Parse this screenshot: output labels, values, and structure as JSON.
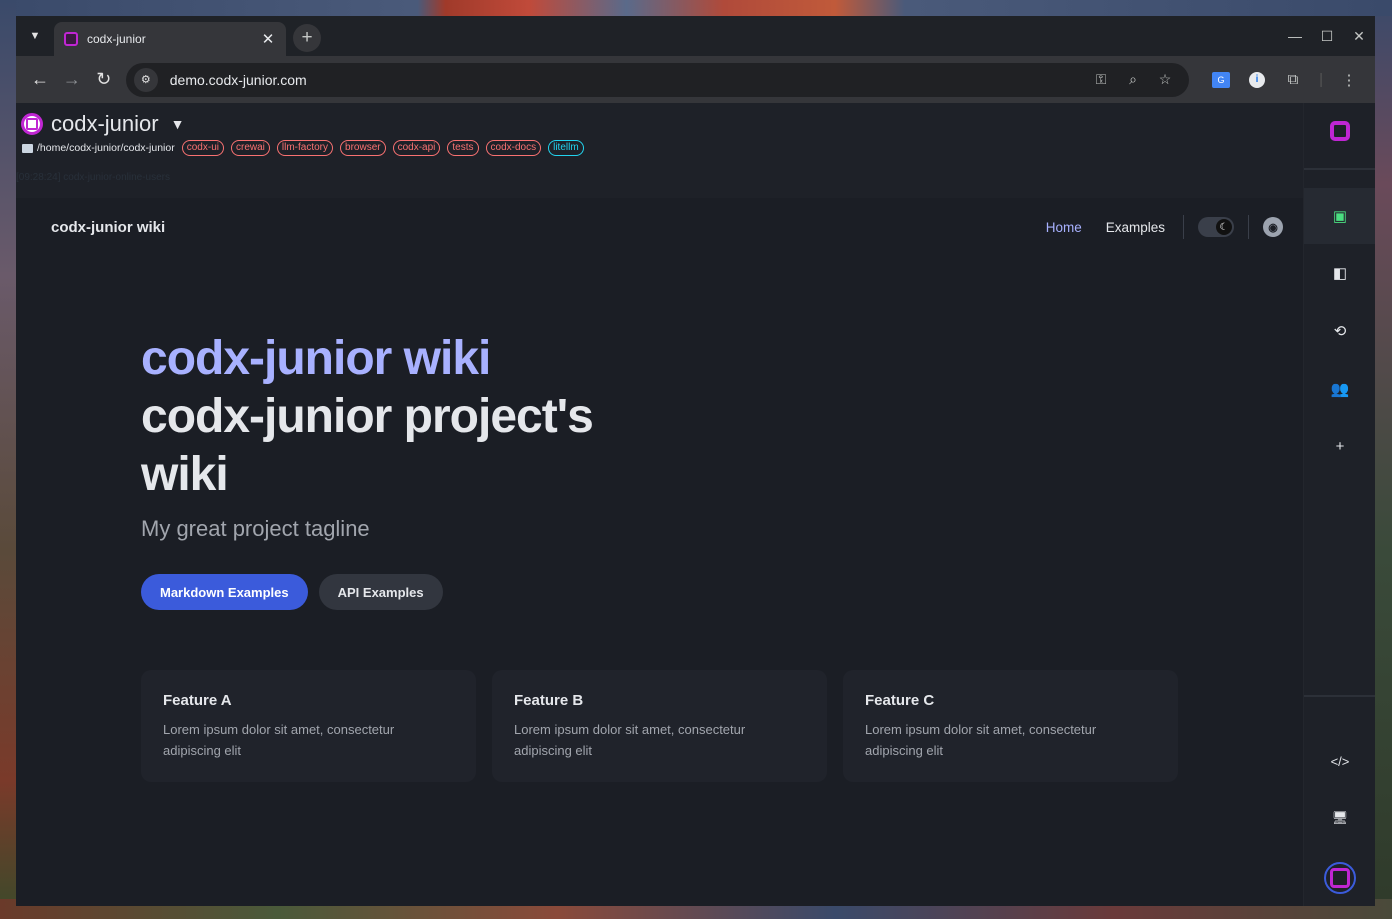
{
  "browser": {
    "tab_title": "codx-junior",
    "url": "demo.codx-junior.com",
    "new_tab_label": "+",
    "close_tab_label": "✕",
    "minimize_label": "—",
    "maximize_label": "☐",
    "close_label": "✕"
  },
  "app": {
    "project_name": "codx-junior",
    "project_path": "/home/codx-junior/codx-junior",
    "project_tags": [
      {
        "label": "codx-ui",
        "kind": "warn"
      },
      {
        "label": "crewai",
        "kind": "warn"
      },
      {
        "label": "llm-factory",
        "kind": "warn"
      },
      {
        "label": "browser",
        "kind": "warn"
      },
      {
        "label": "codx-api",
        "kind": "warn"
      },
      {
        "label": "tests",
        "kind": "warn"
      },
      {
        "label": "codx-docs",
        "kind": "warn"
      },
      {
        "label": "litellm",
        "kind": "info"
      }
    ],
    "log_line": "[09:28:24] codx-junior-online-users"
  },
  "wiki": {
    "site_title": "codx-junior wiki",
    "nav": {
      "home": "Home",
      "examples": "Examples"
    },
    "hero": {
      "name": "codx-junior wiki",
      "text": "codx-junior project's wiki",
      "tagline": "My great project tagline"
    },
    "actions": {
      "primary": "Markdown Examples",
      "secondary": "API Examples"
    },
    "features": [
      {
        "title": "Feature A",
        "details": "Lorem ipsum dolor sit amet, consectetur adipiscing elit"
      },
      {
        "title": "Feature B",
        "details": "Lorem ipsum dolor sit amet, consectetur adipiscing elit"
      },
      {
        "title": "Feature C",
        "details": "Lorem ipsum dolor sit amet, consectetur adipiscing elit"
      }
    ]
  },
  "sidebar": {
    "items": [
      {
        "icon": "book-plus-icon",
        "glyph": "▣",
        "active": true
      },
      {
        "icon": "board-icon",
        "glyph": "◧",
        "active": false
      },
      {
        "icon": "sync-icon",
        "glyph": "⟲",
        "active": false
      },
      {
        "icon": "users-icon",
        "glyph": "👥",
        "active": false
      },
      {
        "icon": "plus-icon",
        "glyph": "+",
        "active": false
      }
    ],
    "bottom_items": [
      {
        "icon": "code-icon",
        "glyph": "</>"
      },
      {
        "icon": "monitor-icon",
        "glyph": "🖥"
      }
    ]
  },
  "colors": {
    "accent": "#a8b1ff",
    "primary_button": "#3b5bdb",
    "brand": "#c026d3",
    "tag_warn": "#f87171",
    "tag_info": "#22d3ee"
  }
}
